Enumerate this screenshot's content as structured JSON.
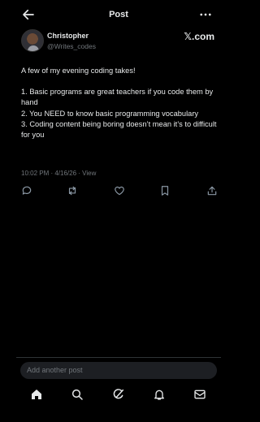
{
  "header": {
    "back_icon": "arrow-left-icon",
    "title": "Post",
    "more_icon": "more-horizontal-icon"
  },
  "author": {
    "name": "Christopher",
    "handle": "@Writes_codes",
    "brand": "𝕏.com"
  },
  "post": {
    "intro": "A few of my evening coding takes!",
    "points": [
      "1. Basic programs are great teachers if you code them by hand",
      "2. You NEED to know basic programming vocabulary",
      "3. Coding content being boring doesn’t mean it’s to difficult for you"
    ],
    "time": "10:02 PM",
    "date": "4/16/26",
    "separator": " · ",
    "view_label": "View"
  },
  "actions": [
    "reply-icon",
    "repost-icon",
    "like-icon",
    "bookmark-icon",
    "share-icon"
  ],
  "composer": {
    "placeholder": "Add another post"
  },
  "tabbar": [
    "home-icon",
    "search-icon",
    "grok-icon",
    "notifications-icon",
    "messages-icon"
  ],
  "colors": {
    "background": "#000000",
    "text": "#e7e9ea",
    "muted": "#71767b",
    "input_bg": "#1d1f23"
  }
}
